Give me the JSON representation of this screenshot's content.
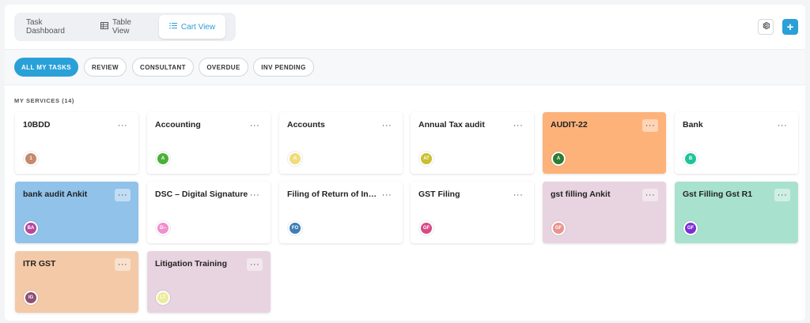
{
  "view_tabs": [
    {
      "label": "Task Dashboard",
      "icon": "",
      "active": false
    },
    {
      "label": "Table View",
      "icon": "table-icon",
      "active": false
    },
    {
      "label": "Cart View",
      "icon": "list-icon",
      "active": true
    }
  ],
  "toolbar": {
    "settings_icon": "gear-icon",
    "add_icon": "plus-icon"
  },
  "filters": [
    {
      "label": "ALL MY TASKS",
      "active": true
    },
    {
      "label": "REVIEW",
      "active": false
    },
    {
      "label": "CONSULTANT",
      "active": false
    },
    {
      "label": "OVERDUE",
      "active": false
    },
    {
      "label": "INV PENDING",
      "active": false
    }
  ],
  "section": {
    "title": "MY SERVICES (14)"
  },
  "cards": [
    {
      "title": "10BDD",
      "initials": "1",
      "bg": "#ffffff",
      "avatar_color": "#c58a6e",
      "menu": "···"
    },
    {
      "title": "Accounting",
      "initials": "A",
      "bg": "#ffffff",
      "avatar_color": "#4caf3a",
      "menu": "···"
    },
    {
      "title": "Accounts",
      "initials": "A",
      "bg": "#ffffff",
      "avatar_color": "#f0dc7a",
      "menu": "···"
    },
    {
      "title": "Annual Tax audit",
      "initials": "AT",
      "bg": "#ffffff",
      "avatar_color": "#c9bf2f",
      "menu": "···"
    },
    {
      "title": "AUDIT-22",
      "initials": "A",
      "bg": "#fdb27a",
      "avatar_color": "#2e7d32",
      "menu": "···"
    },
    {
      "title": "Bank",
      "initials": "B",
      "bg": "#ffffff",
      "avatar_color": "#1fc49a",
      "menu": "···"
    },
    {
      "title": "bank audit Ankit",
      "initials": "BA",
      "bg": "#90c2ea",
      "avatar_color": "#b5489e",
      "menu": "···"
    },
    {
      "title": "DSC – Digital Signature",
      "initials": "D–",
      "bg": "#ffffff",
      "avatar_color": "#f08fd0",
      "menu": "···"
    },
    {
      "title": "Filing of Return of Income",
      "initials": "FO",
      "bg": "#ffffff",
      "avatar_color": "#3d7fb6",
      "menu": "···"
    },
    {
      "title": "GST Filing",
      "initials": "GF",
      "bg": "#ffffff",
      "avatar_color": "#d84a86",
      "menu": "···"
    },
    {
      "title": "gst filling Ankit",
      "initials": "GF",
      "bg": "#e8d3e0",
      "avatar_color": "#e9938e",
      "menu": "···"
    },
    {
      "title": "Gst Filling Gst R1",
      "initials": "GF",
      "bg": "#a8e2cf",
      "avatar_color": "#7b2fd6",
      "menu": "···"
    },
    {
      "title": "ITR GST",
      "initials": "IG",
      "bg": "#f3c9a7",
      "avatar_color": "#8e4f73",
      "menu": "···"
    },
    {
      "title": "Litigation Training",
      "initials": "LT",
      "bg": "#e8d3e0",
      "avatar_color": "#ecec9e",
      "menu": "···"
    }
  ],
  "colors": {
    "accent": "#2aa0d8"
  }
}
